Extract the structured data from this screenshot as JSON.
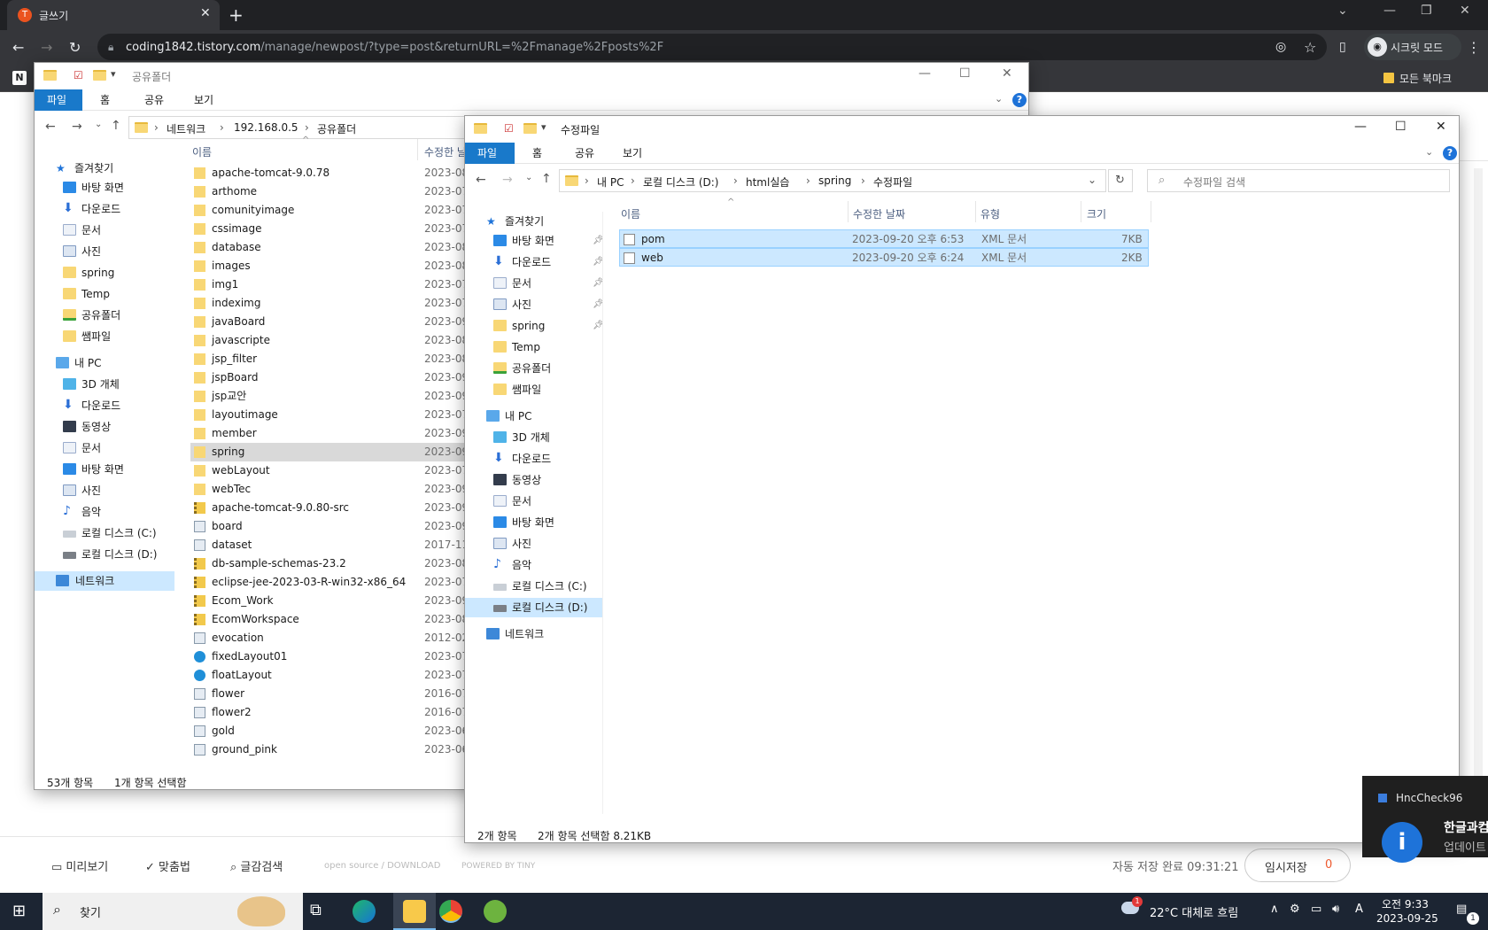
{
  "browser": {
    "tab_title": "글쓰기",
    "tab_favicon": "T",
    "url_host": "coding1842.tistory.com",
    "url_path": "/manage/newpost/?type=post&returnURL=%2Fmanage%2Fposts%2F",
    "incognito_label": "시크릿 모드",
    "bookmarks_label": "모든 북마크"
  },
  "win1": {
    "title": "공유폴더",
    "ribbon_tabs": [
      "파일",
      "홈",
      "공유",
      "보기"
    ],
    "breadcrumb": [
      "네트워크",
      "192.168.0.5",
      "공유폴더"
    ],
    "nav": {
      "favorites": "즐겨찾기",
      "fav_items": [
        "바탕 화면",
        "다운로드",
        "문서",
        "사진",
        "spring",
        "Temp",
        "공유폴더",
        "쌤파일"
      ],
      "pc": "내 PC",
      "pc_items": [
        "3D 개체",
        "다운로드",
        "동영상",
        "문서",
        "바탕 화면",
        "사진",
        "음악",
        "로컬 디스크 (C:)",
        "로컬 디스크 (D:)"
      ],
      "network": "네트워크"
    },
    "col_name": "이름",
    "col_date": "수정한 날",
    "files": [
      {
        "name": "apache-tomcat-9.0.78",
        "date": "2023-08",
        "type": "folder"
      },
      {
        "name": "arthome",
        "date": "2023-07",
        "type": "folder"
      },
      {
        "name": "comunityimage",
        "date": "2023-07",
        "type": "folder"
      },
      {
        "name": "cssimage",
        "date": "2023-07",
        "type": "folder"
      },
      {
        "name": "database",
        "date": "2023-08",
        "type": "folder"
      },
      {
        "name": "images",
        "date": "2023-08",
        "type": "folder"
      },
      {
        "name": "img1",
        "date": "2023-07",
        "type": "folder"
      },
      {
        "name": "indeximg",
        "date": "2023-07",
        "type": "folder"
      },
      {
        "name": "javaBoard",
        "date": "2023-09",
        "type": "folder"
      },
      {
        "name": "javascripte",
        "date": "2023-08",
        "type": "folder"
      },
      {
        "name": "jsp_filter",
        "date": "2023-08",
        "type": "folder"
      },
      {
        "name": "jspBoard",
        "date": "2023-09",
        "type": "folder"
      },
      {
        "name": "jsp교안",
        "date": "2023-09",
        "type": "folder"
      },
      {
        "name": "layoutimage",
        "date": "2023-07",
        "type": "folder"
      },
      {
        "name": "member",
        "date": "2023-09",
        "type": "folder"
      },
      {
        "name": "spring",
        "date": "2023-09",
        "type": "folder"
      },
      {
        "name": "webLayout",
        "date": "2023-07",
        "type": "folder"
      },
      {
        "name": "webTec",
        "date": "2023-09",
        "type": "folder"
      },
      {
        "name": "apache-tomcat-9.0.80-src",
        "date": "2023-09",
        "type": "zip"
      },
      {
        "name": "board",
        "date": "2023-09",
        "type": "file"
      },
      {
        "name": "dataset",
        "date": "2017-11",
        "type": "file"
      },
      {
        "name": "db-sample-schemas-23.2",
        "date": "2023-08",
        "type": "zip"
      },
      {
        "name": "eclipse-jee-2023-03-R-win32-x86_64",
        "date": "2023-07",
        "type": "zip"
      },
      {
        "name": "Ecom_Work",
        "date": "2023-09",
        "type": "zip"
      },
      {
        "name": "EcomWorkspace",
        "date": "2023-08",
        "type": "zip"
      },
      {
        "name": "evocation",
        "date": "2012-02",
        "type": "file"
      },
      {
        "name": "fixedLayout01",
        "date": "2023-07",
        "type": "edge"
      },
      {
        "name": "floatLayout",
        "date": "2023-07",
        "type": "edge"
      },
      {
        "name": "flower",
        "date": "2016-07",
        "type": "file"
      },
      {
        "name": "flower2",
        "date": "2016-07",
        "type": "file"
      },
      {
        "name": "gold",
        "date": "2023-06",
        "type": "file"
      },
      {
        "name": "ground_pink",
        "date": "2023-06",
        "type": "file"
      }
    ],
    "status_count": "53개 항목",
    "status_sel": "1개 항목 선택함"
  },
  "win2": {
    "title": "수정파일",
    "ribbon_tabs": [
      "파일",
      "홈",
      "공유",
      "보기"
    ],
    "breadcrumb": [
      "내 PC",
      "로컬 디스크 (D:)",
      "html실습",
      "spring",
      "수정파일"
    ],
    "search_placeholder": "수정파일 검색",
    "nav": {
      "favorites": "즐겨찾기",
      "fav_items": [
        "바탕 화면",
        "다운로드",
        "문서",
        "사진",
        "spring",
        "Temp",
        "공유폴더",
        "쌤파일"
      ],
      "pc": "내 PC",
      "pc_items": [
        "3D 개체",
        "다운로드",
        "동영상",
        "문서",
        "바탕 화면",
        "사진",
        "음악",
        "로컬 디스크 (C:)",
        "로컬 디스크 (D:)"
      ],
      "network": "네트워크"
    },
    "cols": [
      "이름",
      "수정한 날짜",
      "유형",
      "크기"
    ],
    "files": [
      {
        "name": "pom",
        "date": "2023-09-20 오후 6:53",
        "type": "XML 문서",
        "size": "7KB"
      },
      {
        "name": "web",
        "date": "2023-09-20 오후 6:24",
        "type": "XML 문서",
        "size": "2KB"
      }
    ],
    "status_count": "2개 항목",
    "status_sel": "2개 항목 선택함 8.21KB"
  },
  "editor": {
    "preview": "미리보기",
    "spell": "맞춤법",
    "search": "글감검색",
    "opensource": "open source / DOWNLOAD",
    "powered": "POWERED BY TINY",
    "autosave": "자동 저장 완료 09:31:21",
    "temp_save": "임시저장",
    "temp_count": "0"
  },
  "toast": {
    "app": "HncCheck96",
    "heading": "한글과컴퓨터",
    "sub": "업데이트"
  },
  "taskbar": {
    "search": "찾기",
    "weather": "22°C 대체로 흐림",
    "weather_badge": "1",
    "ime": "A",
    "time": "오전 9:33",
    "date": "2023-09-25",
    "notif_count": "1"
  },
  "colors": {
    "chrome_dark": "#202124",
    "ribbon_file": "#1979ca",
    "selection": "#cce8ff",
    "taskbar": "#1c2533"
  }
}
